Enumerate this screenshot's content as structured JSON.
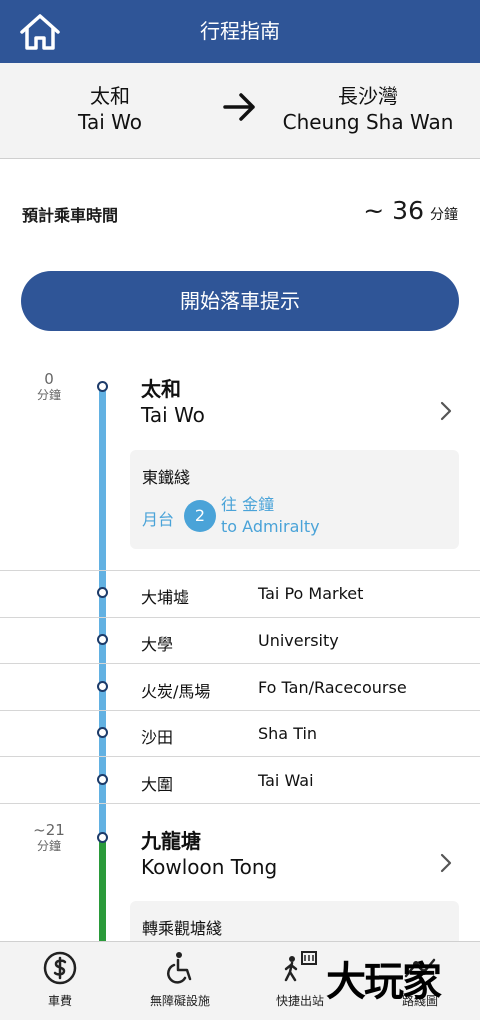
{
  "header": {
    "title": "行程指南",
    "home_icon": "home-icon"
  },
  "route": {
    "from_zh": "太和",
    "from_en": "Tai Wo",
    "to_zh": "長沙灣",
    "to_en": "Cheung Sha Wan",
    "arrow_icon": "arrow-right-icon"
  },
  "eta": {
    "label": "預計乘車時間",
    "value": "~ 36",
    "unit": "分鐘"
  },
  "alert_button": {
    "label": "開始落車提示"
  },
  "journey": {
    "start": {
      "time": "0",
      "time_unit": "分鐘",
      "name_zh": "太和",
      "name_en": "Tai Wo",
      "line_name": "東鐵綫",
      "platform_label": "月台",
      "platform_number": "2",
      "dest_zh": "往 金鐘",
      "dest_en": "to Admiralty"
    },
    "stops": [
      {
        "zh": "大埔墟",
        "en": "Tai Po Market"
      },
      {
        "zh": "大學",
        "en": "University"
      },
      {
        "zh": "火炭/馬場",
        "en": "Fo Tan/Racecourse"
      },
      {
        "zh": "沙田",
        "en": "Sha Tin"
      },
      {
        "zh": "大圍",
        "en": "Tai Wai"
      }
    ],
    "interchange": {
      "time": "~21",
      "time_unit": "分鐘",
      "name_zh": "九龍塘",
      "name_en": "Kowloon Tong",
      "transfer_text": "轉乘觀塘綫"
    }
  },
  "tabs": [
    {
      "label": "車費",
      "icon": "dollar-icon"
    },
    {
      "label": "無障礙設施",
      "icon": "wheelchair-icon"
    },
    {
      "label": "快捷出站",
      "icon": "exit-walk-icon"
    },
    {
      "label": "路綫圖",
      "icon": "route-map-icon"
    }
  ],
  "watermark": "大玩家",
  "colors": {
    "header": "#2f5597",
    "east_rail": "#62b1e2",
    "kwun_tong": "#2a9a3a",
    "platform": "#4aa3d8"
  }
}
